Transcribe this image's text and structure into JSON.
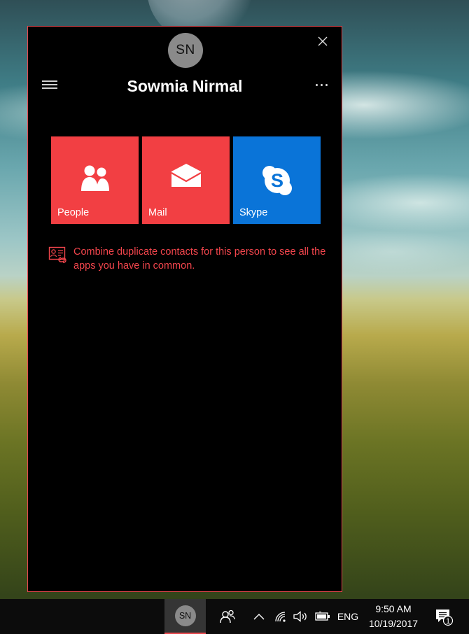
{
  "window": {
    "avatar_initials": "SN",
    "contact_name": "Sowmia Nirmal",
    "close_icon": "close-icon",
    "menu_icon": "hamburger-menu-icon",
    "more_icon": "more-options-icon"
  },
  "apps": [
    {
      "label": "People",
      "icon": "people-icon",
      "color": "#f23f43"
    },
    {
      "label": "Mail",
      "icon": "mail-icon",
      "color": "#f23f43"
    },
    {
      "label": "Skype",
      "icon": "skype-icon",
      "color": "#0a74d8"
    }
  ],
  "notice": {
    "icon": "contact-card-link-icon",
    "text": "Combine duplicate contacts for this person to see all the apps you have in common.",
    "color": "#f2454c"
  },
  "taskbar": {
    "pinned_contact_initials": "SN",
    "people_icon": "people-icon",
    "chevron_icon": "chevron-up-icon",
    "wifi_icon": "wifi-icon",
    "volume_icon": "volume-icon",
    "battery_icon": "battery-icon",
    "language": "ENG",
    "time": "9:50 AM",
    "date": "10/19/2017",
    "notification_count": "1",
    "action_center_icon": "action-center-icon"
  },
  "colors": {
    "accent": "#e8484e",
    "panel_bg": "#000000",
    "taskbar_bg": "#0c0c0c"
  }
}
